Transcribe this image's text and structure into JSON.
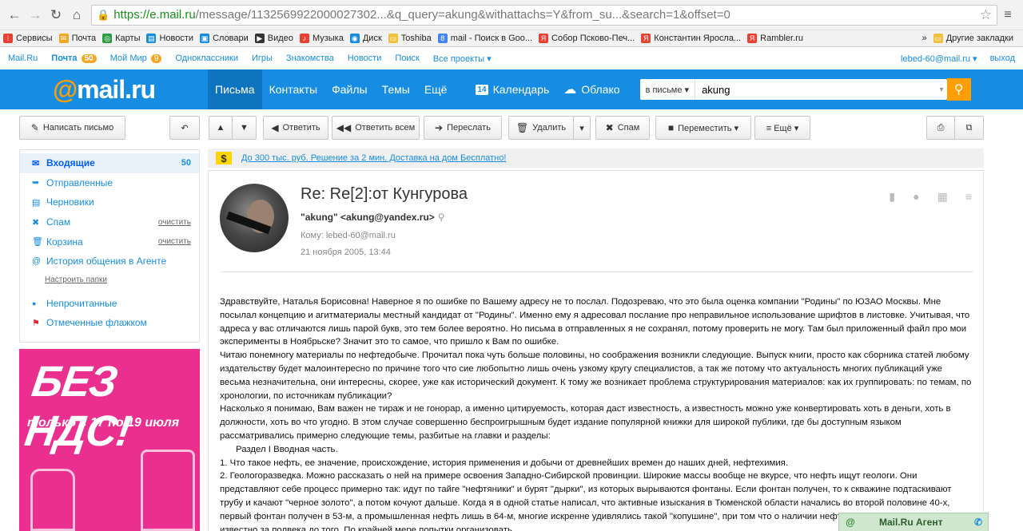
{
  "browser": {
    "url_host": "https://e.mail.ru",
    "url_path": "/message/1132569922000027302...&q_query=akung&withattachs=Y&from_su...&search=1&offset=0",
    "bookmarks": [
      {
        "label": "Сервисы",
        "color": "#e94235"
      },
      {
        "label": "Почта",
        "color": "#f5a623"
      },
      {
        "label": "Карты",
        "color": "#2e9b45"
      },
      {
        "label": "Новости",
        "color": "#168de2"
      },
      {
        "label": "Словари",
        "color": "#168de2"
      },
      {
        "label": "Видео",
        "color": "#333333"
      },
      {
        "label": "Музыка",
        "color": "#e94235"
      },
      {
        "label": "Диск",
        "color": "#168de2"
      },
      {
        "label": "Toshiba",
        "color": "#f0c040"
      },
      {
        "label": "mail - Поиск в Goo...",
        "color": "#4285f4"
      },
      {
        "label": "Собор Псково-Печ...",
        "color": "#e94235"
      },
      {
        "label": "Константин Яросла...",
        "color": "#e94235"
      },
      {
        "label": "Rambler.ru",
        "color": "#e94235"
      }
    ],
    "more": "»",
    "other_bookmarks": "Другие закладки"
  },
  "portal": {
    "links": [
      "Mail.Ru",
      "Почта",
      "Мой Мир",
      "Одноклассники",
      "Игры",
      "Знакомства",
      "Новости",
      "Поиск",
      "Все проекты ▾"
    ],
    "mail_count": "50",
    "mir_count": "9",
    "user": "lebed-60@mail.ru ▾",
    "logout": "выход"
  },
  "header": {
    "logo_at": "@",
    "logo_text": "mail.ru",
    "nav": [
      "Письма",
      "Контакты",
      "Файлы",
      "Темы",
      "Ещё"
    ],
    "calendar": "Календарь",
    "calendar_day": "14",
    "cloud": "Облако",
    "search_scope": "в письме ▾",
    "search_value": "akung"
  },
  "toolbar": {
    "compose": "Написать письмо",
    "reply": "Ответить",
    "reply_all": "Ответить всем",
    "forward": "Переслать",
    "delete": "Удалить",
    "spam": "Спам",
    "move": "Переместить ▾",
    "more": "≡ Ещё ▾"
  },
  "folders": [
    {
      "label": "Входящие",
      "count": "50",
      "icon": "✉"
    },
    {
      "label": "Отправленные",
      "icon": "➥"
    },
    {
      "label": "Черновики",
      "icon": "▤"
    },
    {
      "label": "Спам",
      "action": "очистить",
      "icon": "✖"
    },
    {
      "label": "Корзина",
      "action": "очистить",
      "icon": "🗑"
    },
    {
      "label": "История общения в Агенте",
      "icon": "@"
    }
  ],
  "setup_folders": "Настроить папки",
  "filters": [
    {
      "label": "Непрочитанные",
      "icon": "●"
    },
    {
      "label": "Отмеченные флажком",
      "icon": "⚑"
    }
  ],
  "promo": {
    "title": "БЕЗ НДС!",
    "subtitle": "только с 17 по 19 июля"
  },
  "ad": {
    "symbol": "$",
    "text": "До 300 тыс. руб. Решение за 2 мин. Доставка на дом Бесплатно!"
  },
  "message": {
    "subject": "Re: Re[2]:от Кунгурова",
    "from": "\"akung\" <akung@yandex.ru>",
    "to": "Кому: lebed-60@mail.ru",
    "date": "21 ноября 2005, 13:44",
    "paragraphs": [
      "Здравствуйте, Наталья Борисовна! Наверное я по ошибке по Вашему адресу не то послал. Подозреваю, что это была оценка компании \"Родины\" по ЮЗАО Москвы. Мне посылал концепцию и агитматериалы местный кандидат от \"Родины\". Именно ему я адресовал послание про неправильное использование шрифтов в листовке. Учитывая, что адреса у вас отличаются лишь парой букв, это тем более вероятно. Но письма в отправленных я не сохранял, потому проверить не могу. Там был приложенный файл про мои эксперименты в Ноябрьске? Значит это то самое, что пришло к Вам по ошибке.",
      "Читаю понемногу материалы по нефтедобыче. Прочитал пока чуть больше половины, но соображения возникли следующие. Выпуск книги, просто как сборника статей любому издательству будет малоинтересно по причине того что сие любопытно лишь очень узкому кругу специалистов, а так же потому что актуальность многих публикаций уже весьма незначительна, они интересны, скорее, уже как исторический документ. К тому же возникает проблема структурирования материалов: как их группировать: по темам, по хронологии, по источникам публикации?",
      "Насколько я понимаю, Вам важен не тираж и не гонорар, а именно цитируемость, которая даст известность, а известность можно уже конвертировать хоть в деньги, хоть в должности, хоть во что угодно. В этом случае совершенно беспроигрышным будет издание популярной книжки для широкой публики, где бы доступным языком рассматривались примерно следующие темы, разбитые на главки и разделы:",
      "Раздел I Вводная часть.",
      "1. Что такое нефть, ее значение, происхождение, история применения и добычи от древнейших времен до наших дней, нефтехимия.",
      "2. Геологоразведка. Можно рассказать о ней на примере освоения Западно-Сибирской провинции. Широкие массы вообще не вкурсе, что нефть ищут геологи. Они представляют себе процесс примерно так: идут по тайге \"нефтяники\" и бурят \"дырки\", из которых вырываются фонтаны. Если фонтан получен, то к скважине подтаскивают трубу и качают \"черное золото\", а потом кочуют дальше. Когда я в одной статье написал, что активные изыскания в Тюменской области начались во второй половине 40-х, первый фонтан получен в 53-м, а промышленная нефть лишь в 64-м, многие искренне удивлялись такой \"копушине\", при том что о наличии нефти в Среднем Приобье было известно за полвека до того. По крайней мере попытки организовать"
    ]
  },
  "agent": {
    "label": "Mail.Ru Агент"
  }
}
